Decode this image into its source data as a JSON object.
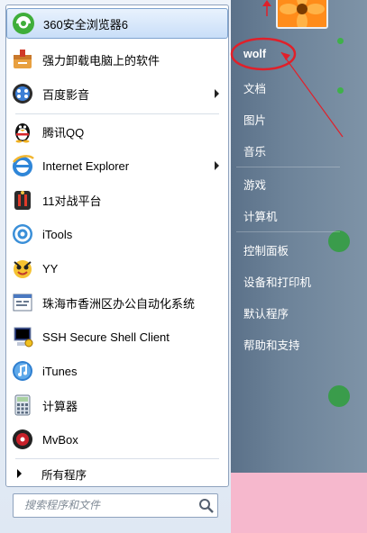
{
  "programs": [
    {
      "label": "360安全浏览器6",
      "icon": "360-browser-icon"
    },
    {
      "label": "强力卸载电脑上的软件",
      "icon": "uninstaller-icon"
    },
    {
      "label": "百度影音",
      "icon": "baidu-player-icon",
      "submenu": true
    },
    {
      "label": "腾讯QQ",
      "icon": "qq-penguin-icon"
    },
    {
      "label": "Internet Explorer",
      "icon": "internet-explorer-icon",
      "submenu": true
    },
    {
      "label": "11对战平台",
      "icon": "11-platform-icon"
    },
    {
      "label": "iTools",
      "icon": "itools-icon"
    },
    {
      "label": "YY",
      "icon": "yy-icon"
    },
    {
      "label": "珠海市香洲区办公自动化系统",
      "icon": "office-system-icon"
    },
    {
      "label": "SSH Secure Shell Client",
      "icon": "ssh-client-icon"
    },
    {
      "label": "iTunes",
      "icon": "itunes-icon"
    },
    {
      "label": "计算器",
      "icon": "calculator-icon"
    },
    {
      "label": "MvBox",
      "icon": "mvbox-icon"
    }
  ],
  "all_programs": "所有程序",
  "search": {
    "placeholder": "搜索程序和文件"
  },
  "right_items": [
    {
      "label": "wolf"
    },
    {
      "label": "文档"
    },
    {
      "label": "图片"
    },
    {
      "label": "音乐"
    },
    {
      "label": "游戏"
    },
    {
      "label": "计算机"
    },
    {
      "label": "控制面板"
    },
    {
      "label": "设备和打印机"
    },
    {
      "label": "默认程序"
    },
    {
      "label": "帮助和支持"
    }
  ],
  "colors": {
    "annotation": "#e0202a",
    "right_pane": "#6d8399",
    "pink_background": "#f6b8cd"
  }
}
